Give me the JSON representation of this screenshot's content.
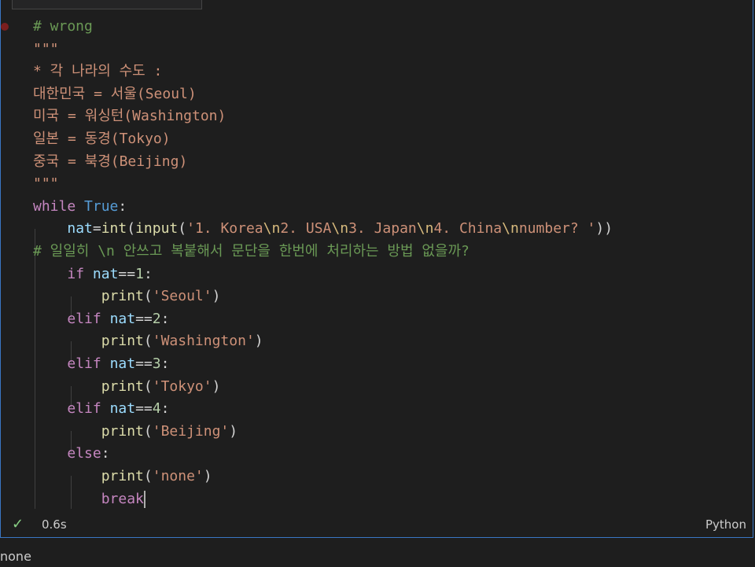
{
  "code_lines": [
    [
      {
        "t": "# wrong",
        "c": "com"
      }
    ],
    [
      {
        "t": "\"\"\"",
        "c": "str"
      }
    ],
    [
      {
        "t": "* 각 나라의 수도 :",
        "c": "str"
      }
    ],
    [
      {
        "t": "대한민국 = 서울(Seoul)",
        "c": "str"
      }
    ],
    [
      {
        "t": "미국 = 워싱턴(Washington)",
        "c": "str"
      }
    ],
    [
      {
        "t": "일본 = 동경(Tokyo)",
        "c": "str"
      }
    ],
    [
      {
        "t": "중국 = 북경(Beijing)",
        "c": "str"
      }
    ],
    [
      {
        "t": "\"\"\"",
        "c": "str"
      }
    ],
    [
      {
        "t": "while",
        "c": "kw"
      },
      {
        "t": " ",
        "c": "op"
      },
      {
        "t": "True",
        "c": "kw2"
      },
      {
        "t": ":",
        "c": "op"
      }
    ],
    [
      {
        "t": "    ",
        "c": "op"
      },
      {
        "t": "nat",
        "c": "var"
      },
      {
        "t": "=",
        "c": "op"
      },
      {
        "t": "int",
        "c": "fn"
      },
      {
        "t": "(",
        "c": "op"
      },
      {
        "t": "input",
        "c": "fn"
      },
      {
        "t": "(",
        "c": "op"
      },
      {
        "t": "'1. Korea",
        "c": "str"
      },
      {
        "t": "\\n",
        "c": "esc"
      },
      {
        "t": "2. USA",
        "c": "str"
      },
      {
        "t": "\\n",
        "c": "esc"
      },
      {
        "t": "3. Japan",
        "c": "str"
      },
      {
        "t": "\\n",
        "c": "esc"
      },
      {
        "t": "4. China",
        "c": "str"
      },
      {
        "t": "\\n",
        "c": "esc"
      },
      {
        "t": "number? '",
        "c": "str"
      },
      {
        "t": "))",
        "c": "op"
      }
    ],
    [
      {
        "t": "# 일일히 \\n 안쓰고 복붙해서 문단을 한번에 처리하는 방법 없을까?",
        "c": "com"
      }
    ],
    [
      {
        "t": "    ",
        "c": "op"
      },
      {
        "t": "if",
        "c": "kw"
      },
      {
        "t": " ",
        "c": "op"
      },
      {
        "t": "nat",
        "c": "var"
      },
      {
        "t": "==",
        "c": "op"
      },
      {
        "t": "1",
        "c": "num"
      },
      {
        "t": ":",
        "c": "op"
      }
    ],
    [
      {
        "t": "        ",
        "c": "op"
      },
      {
        "t": "print",
        "c": "fn"
      },
      {
        "t": "(",
        "c": "op"
      },
      {
        "t": "'Seoul'",
        "c": "str"
      },
      {
        "t": ")",
        "c": "op"
      }
    ],
    [
      {
        "t": "    ",
        "c": "op"
      },
      {
        "t": "elif",
        "c": "kw"
      },
      {
        "t": " ",
        "c": "op"
      },
      {
        "t": "nat",
        "c": "var"
      },
      {
        "t": "==",
        "c": "op"
      },
      {
        "t": "2",
        "c": "num"
      },
      {
        "t": ":",
        "c": "op"
      }
    ],
    [
      {
        "t": "        ",
        "c": "op"
      },
      {
        "t": "print",
        "c": "fn"
      },
      {
        "t": "(",
        "c": "op"
      },
      {
        "t": "'Washington'",
        "c": "str"
      },
      {
        "t": ")",
        "c": "op"
      }
    ],
    [
      {
        "t": "    ",
        "c": "op"
      },
      {
        "t": "elif",
        "c": "kw"
      },
      {
        "t": " ",
        "c": "op"
      },
      {
        "t": "nat",
        "c": "var"
      },
      {
        "t": "==",
        "c": "op"
      },
      {
        "t": "3",
        "c": "num"
      },
      {
        "t": ":",
        "c": "op"
      }
    ],
    [
      {
        "t": "        ",
        "c": "op"
      },
      {
        "t": "print",
        "c": "fn"
      },
      {
        "t": "(",
        "c": "op"
      },
      {
        "t": "'Tokyo'",
        "c": "str"
      },
      {
        "t": ")",
        "c": "op"
      }
    ],
    [
      {
        "t": "    ",
        "c": "op"
      },
      {
        "t": "elif",
        "c": "kw"
      },
      {
        "t": " ",
        "c": "op"
      },
      {
        "t": "nat",
        "c": "var"
      },
      {
        "t": "==",
        "c": "op"
      },
      {
        "t": "4",
        "c": "num"
      },
      {
        "t": ":",
        "c": "op"
      }
    ],
    [
      {
        "t": "        ",
        "c": "op"
      },
      {
        "t": "print",
        "c": "fn"
      },
      {
        "t": "(",
        "c": "op"
      },
      {
        "t": "'Beijing'",
        "c": "str"
      },
      {
        "t": ")",
        "c": "op"
      }
    ],
    [
      {
        "t": "    ",
        "c": "op"
      },
      {
        "t": "else",
        "c": "kw"
      },
      {
        "t": ":",
        "c": "op"
      }
    ],
    [
      {
        "t": "        ",
        "c": "op"
      },
      {
        "t": "print",
        "c": "fn"
      },
      {
        "t": "(",
        "c": "op"
      },
      {
        "t": "'none'",
        "c": "str"
      },
      {
        "t": ")",
        "c": "op"
      }
    ],
    [
      {
        "t": "        ",
        "c": "op"
      },
      {
        "t": "break",
        "c": "kw"
      }
    ]
  ],
  "status": {
    "check_icon": "check-icon",
    "exec_time": "0.6s",
    "language": "Python"
  },
  "output": {
    "text": "none"
  },
  "colors": {
    "accent_border": "#3a76c4",
    "success": "#89d185"
  }
}
